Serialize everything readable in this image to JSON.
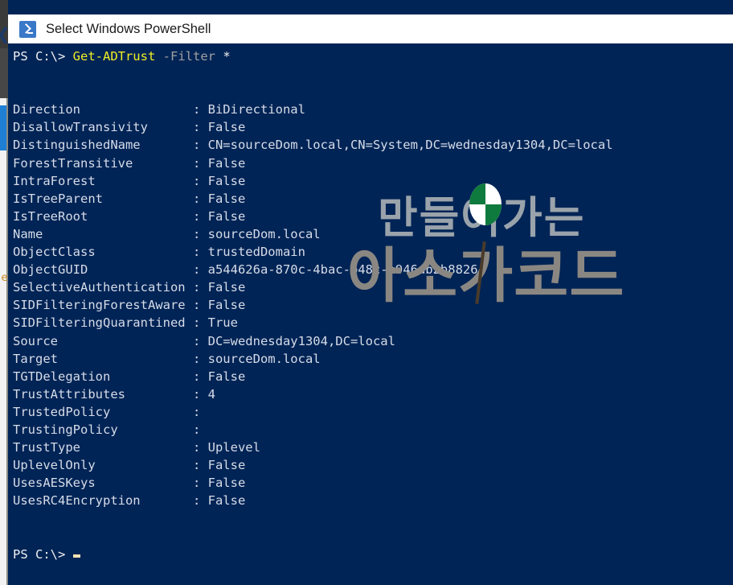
{
  "window": {
    "title": "Select Windows PowerShell",
    "icon": "powershell-icon",
    "background_color": "#012456",
    "titlebar_color": "#ffffff"
  },
  "prompt": {
    "prefix": "PS C:\\> ",
    "command": "Get-ADTrust",
    "parameter": "-Filter",
    "argument": "*"
  },
  "output": {
    "separator": ":",
    "rows": [
      {
        "property": "Direction",
        "value": "BiDirectional"
      },
      {
        "property": "DisallowTransivity",
        "value": "False"
      },
      {
        "property": "DistinguishedName",
        "value": "CN=sourceDom.local,CN=System,DC=wednesday1304,DC=local"
      },
      {
        "property": "ForestTransitive",
        "value": "False"
      },
      {
        "property": "IntraForest",
        "value": "False"
      },
      {
        "property": "IsTreeParent",
        "value": "False"
      },
      {
        "property": "IsTreeRoot",
        "value": "False"
      },
      {
        "property": "Name",
        "value": "sourceDom.local"
      },
      {
        "property": "ObjectClass",
        "value": "trustedDomain"
      },
      {
        "property": "ObjectGUID",
        "value": "a544626a-870c-4bac-b48c-a946ab2b8826"
      },
      {
        "property": "SelectiveAuthentication",
        "value": "False"
      },
      {
        "property": "SIDFilteringForestAware",
        "value": "False"
      },
      {
        "property": "SIDFilteringQuarantined",
        "value": "True"
      },
      {
        "property": "Source",
        "value": "DC=wednesday1304,DC=local"
      },
      {
        "property": "Target",
        "value": "sourceDom.local"
      },
      {
        "property": "TGTDelegation",
        "value": "False"
      },
      {
        "property": "TrustAttributes",
        "value": "4"
      },
      {
        "property": "TrustedPolicy",
        "value": ""
      },
      {
        "property": "TrustingPolicy",
        "value": ""
      },
      {
        "property": "TrustType",
        "value": "Uplevel"
      },
      {
        "property": "UplevelOnly",
        "value": "False"
      },
      {
        "property": "UsesAESKeys",
        "value": "False"
      },
      {
        "property": "UsesRC4Encryption",
        "value": "False"
      }
    ]
  },
  "final_prompt": {
    "prefix": "PS C:\\> ",
    "cursor": "block-underscore"
  },
  "watermark": {
    "top_text": "만들어가는",
    "bottom_text": "아소가코드",
    "text_color": "#9aa3ab",
    "logo_color": "#0f7a3d"
  }
}
